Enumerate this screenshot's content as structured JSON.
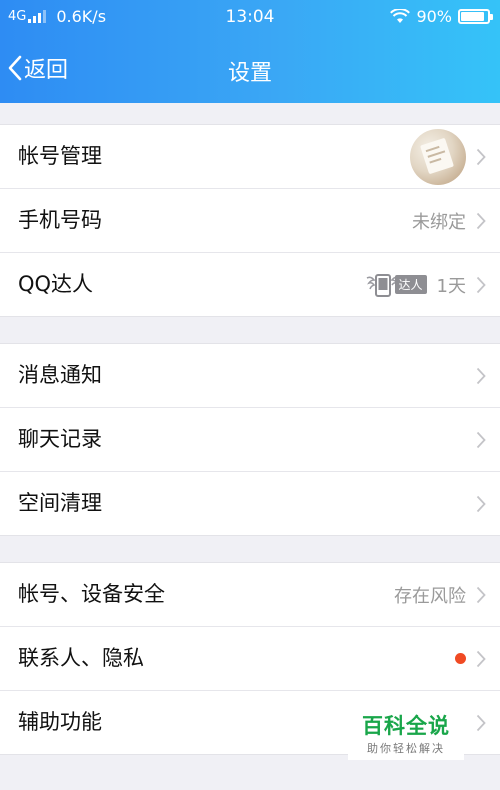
{
  "status_bar": {
    "network": "4G",
    "speed": "0.6K/s",
    "time": "13:04",
    "battery": "90%",
    "battery_level": 0.9
  },
  "header": {
    "back_label": "返回",
    "title": "设置"
  },
  "groups": [
    [
      {
        "label": "帐号管理",
        "value": "",
        "icon": "avatar"
      },
      {
        "label": "手机号码",
        "value": "未绑定"
      },
      {
        "label": "QQ达人",
        "badge": "达人",
        "value": "1天",
        "icon": "phone-wings-icon"
      }
    ],
    [
      {
        "label": "消息通知"
      },
      {
        "label": "聊天记录"
      },
      {
        "label": "空间清理"
      }
    ],
    [
      {
        "label": "帐号、设备安全",
        "value": "存在风险"
      },
      {
        "label": "联系人、隐私",
        "indicator": "red-dot"
      },
      {
        "label": "辅助功能"
      }
    ]
  ],
  "watermark": {
    "title": "百科全说",
    "subtitle": "助你轻松解决"
  },
  "colors": {
    "header_start": "#2e8cf3",
    "header_end": "#35c3f8",
    "alert_dot": "#f04a23",
    "watermark": "#19a64a"
  }
}
